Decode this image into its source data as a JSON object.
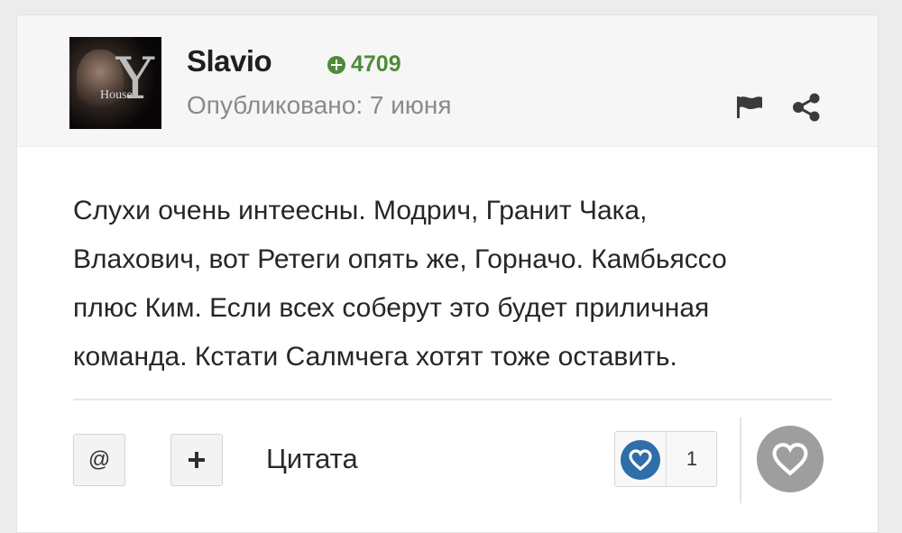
{
  "post": {
    "author": {
      "username": "Slavio",
      "reputation": "4709",
      "avatar_caption": "House"
    },
    "published_label": "Опубликовано: 7 июня",
    "body_lines": [
      "Слухи очень интеесны. Модрич, Гранит Чака,",
      "Влахович, вот Ретеги опять же, Горначо. Камбьяссо",
      "плюс Ким. Если всех соберут это будет приличная",
      "команда. Кстати Салмчега хотят тоже оставить."
    ]
  },
  "actions": {
    "mention_label": "@",
    "quote_label": "Цитата",
    "reactions": {
      "count": "1",
      "badge_icon": "heart-icon",
      "badge_color": "#2f6ea8"
    },
    "like_button_color": "#9e9e9e"
  },
  "colors": {
    "reputation": "#4f8b3a",
    "header_bg": "#f6f6f6",
    "text": "#262626",
    "muted": "#8a8a8a"
  },
  "icons": {
    "report": "flag-icon",
    "share": "share-icon",
    "rep": "plus-circle-icon",
    "multiquote": "plus-icon",
    "like": "heart-icon"
  }
}
